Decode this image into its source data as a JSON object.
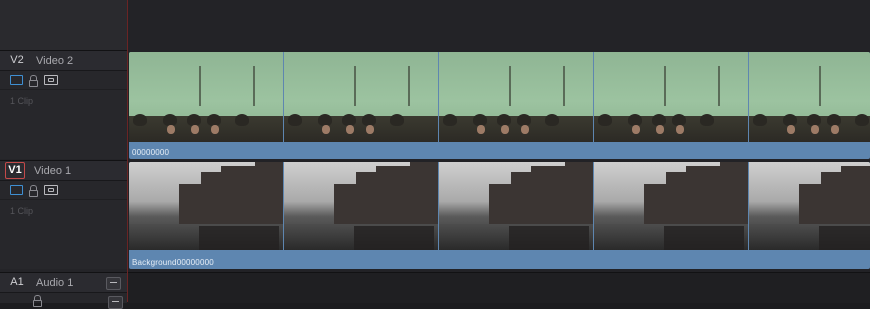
{
  "tracks": [
    {
      "id": "V2",
      "name": "Video 2",
      "clip_count": "1 Clip",
      "selected": false
    },
    {
      "id": "V1",
      "name": "Video 1",
      "clip_count": "1 Clip",
      "selected": true
    },
    {
      "id": "A1",
      "name": "Audio 1"
    }
  ],
  "clips": {
    "v2_clip_name": "00000000",
    "v1_clip_name": "Background00000000"
  },
  "colors": {
    "clip_bar": "#5e86b0",
    "selected_track_border": "#c34a4a",
    "playhead": "#6a2424"
  }
}
